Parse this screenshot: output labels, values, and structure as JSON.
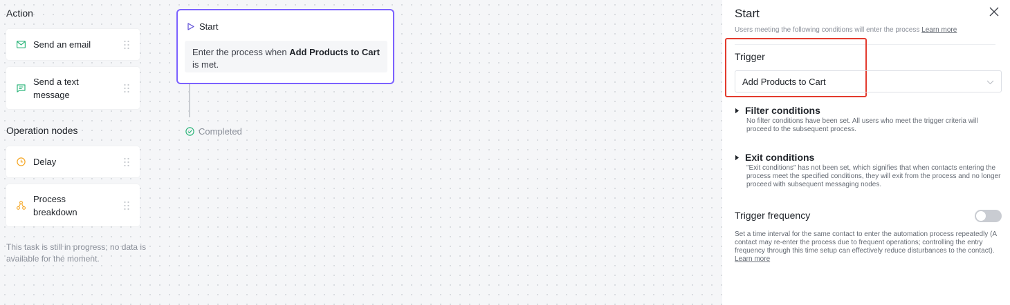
{
  "palette": {
    "action_title": "Action",
    "actions": [
      {
        "label": "Send an email",
        "icon": "mail-icon"
      },
      {
        "label": "Send a text message",
        "icon": "message-icon"
      }
    ],
    "operation_title": "Operation nodes",
    "operations": [
      {
        "label": "Delay",
        "icon": "clock-icon"
      },
      {
        "label": "Process breakdown",
        "icon": "branch-icon"
      }
    ],
    "note": "This task is still in progress; no data is available for the moment."
  },
  "canvas": {
    "start_label": "Start",
    "start_desc_prefix": "Enter the process when ",
    "start_desc_trigger": "Add Products to Cart",
    "start_desc_suffix": " is met.",
    "completed_label": "Completed"
  },
  "panel": {
    "title": "Start",
    "subtitle": "Users meeting the following conditions will enter the process",
    "subtitle_link": "Learn more",
    "trigger_label": "Trigger",
    "trigger_value": "Add Products to Cart",
    "filter_title": "Filter conditions",
    "filter_desc": "No filter conditions have been set. All users who meet the trigger criteria will proceed to the subsequent process.",
    "exit_title": "Exit conditions",
    "exit_desc": "\"Exit conditions\" has not been set, which signifies that when contacts entering the process meet the specified conditions, they will exit from the process and no longer proceed with subsequent messaging nodes.",
    "freq_title": "Trigger frequency",
    "freq_enabled": false,
    "freq_desc": "Set a time interval for the same contact to enter the automation process repeatedly (A contact may re-enter the process due to frequent operations; controlling the entry frequency through this time setup can effectively reduce disturbances to the contact).",
    "freq_link": "Learn more"
  },
  "colors": {
    "accent": "#7b61ff",
    "action_icon": "#2fb67c",
    "operation_icon": "#f5a623",
    "highlight_border": "#e33b2e"
  }
}
